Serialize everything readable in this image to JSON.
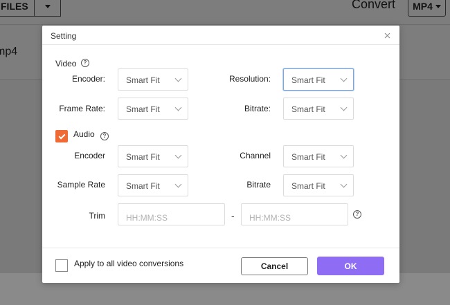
{
  "background": {
    "files_label": "FILES",
    "convert_label": "Convert",
    "format_label": "MP4",
    "file_name": "mp4"
  },
  "dialog": {
    "title": "Setting",
    "video": {
      "section_label": "Video",
      "encoder": {
        "label": "Encoder:",
        "value": "Smart Fit"
      },
      "resolution": {
        "label": "Resolution:",
        "value": "Smart Fit"
      },
      "frame_rate": {
        "label": "Frame Rate:",
        "value": "Smart Fit"
      },
      "bitrate": {
        "label": "Bitrate:",
        "value": "Smart Fit"
      }
    },
    "audio": {
      "section_label": "Audio",
      "checked": true,
      "encoder": {
        "label": "Encoder",
        "value": "Smart Fit"
      },
      "channel": {
        "label": "Channel",
        "value": "Smart Fit"
      },
      "sample_rate": {
        "label": "Sample Rate",
        "value": "Smart Fit"
      },
      "bitrate": {
        "label": "Bitrate",
        "value": "Smart Fit"
      }
    },
    "trim": {
      "label": "Trim",
      "start_placeholder": "HH:MM:SS",
      "separator": "-",
      "end_placeholder": "HH:MM:SS"
    },
    "footer": {
      "apply_all_label": "Apply to all video conversions",
      "apply_all_checked": false,
      "cancel_label": "Cancel",
      "ok_label": "OK"
    }
  },
  "colors": {
    "accent_checkbox": "#f06a35",
    "ok_button": "#8e6cf4",
    "focus_border": "#7ea7d8"
  }
}
